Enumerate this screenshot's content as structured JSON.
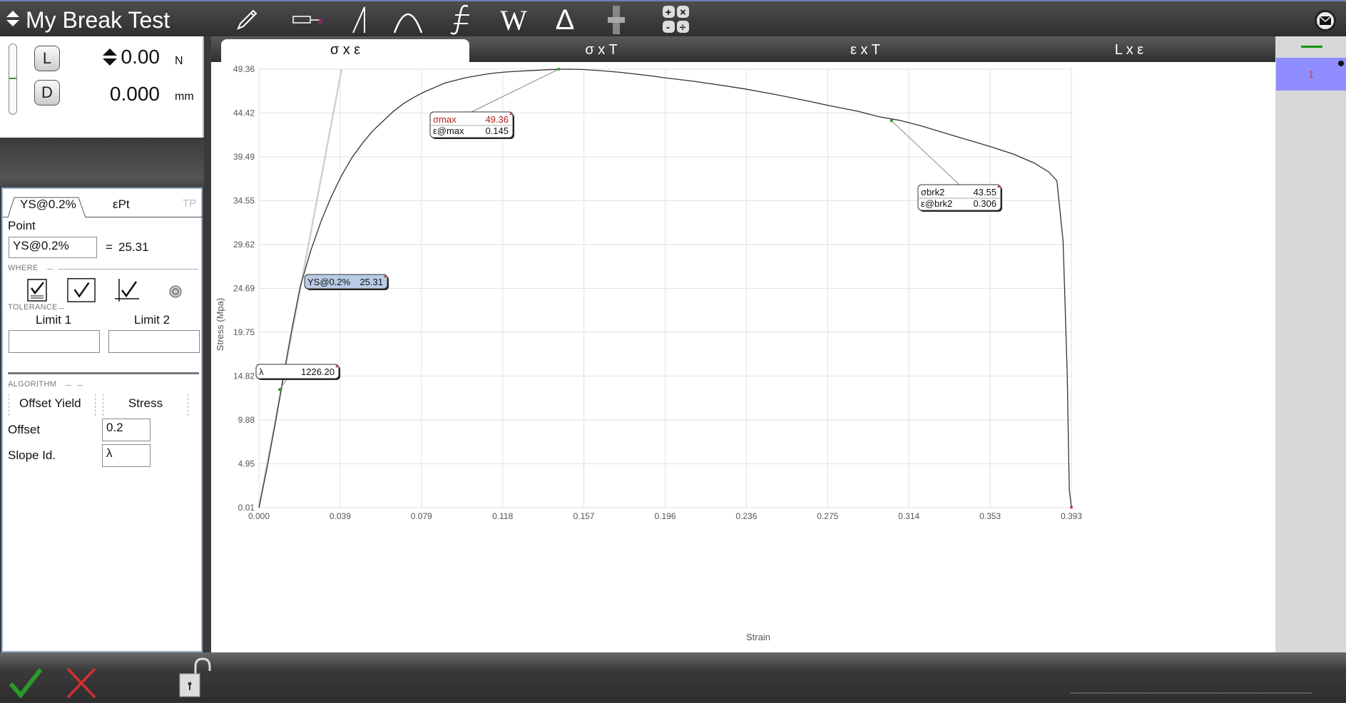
{
  "app": {
    "title": "My Break Test"
  },
  "toolbar": {
    "icons": [
      "pencil-icon",
      "extensometer-icon",
      "slope-icon",
      "curve-peak-icon",
      "integral-icon",
      "work-icon",
      "delta-icon",
      "specimen-icon",
      "calculator-icon"
    ],
    "labels": {
      "work": "W",
      "delta": "Δ"
    },
    "calc": [
      "+",
      "×",
      "-",
      "÷"
    ]
  },
  "readout": {
    "load_btn": "L",
    "disp_btn": "D",
    "load_value": "0.00",
    "load_unit": "N",
    "disp_value": "0.000",
    "disp_unit": "mm"
  },
  "props": {
    "tabs": [
      "YS@0.2%",
      "εPt",
      "TP"
    ],
    "point_label": "Point",
    "point_name": "YS@0.2%",
    "point_eq": "=",
    "point_value": "25.31",
    "where_header": "WHERE",
    "tolerance_header": "TOLERANCE",
    "limit1_label": "Limit 1",
    "limit2_label": "Limit 2",
    "limit1_value": "",
    "limit2_value": "",
    "algorithm_header": "ALGORITHM",
    "algo_option1": "Offset Yield",
    "algo_option2": "Stress",
    "offset_label": "Offset",
    "offset_value": "0.2",
    "slope_label": "Slope Id.",
    "slope_value": "λ"
  },
  "chart_tabs": [
    "σ x ε",
    "σ x T",
    "ε x T",
    "L x ε"
  ],
  "right_panel": {
    "item": "1"
  },
  "colors": {
    "accent_green": "#2a9b2a",
    "cancel_red": "#d23030",
    "selection": "#8f8dff",
    "label_highlight": "#b9cbe6",
    "max_red": "#b01c1c"
  },
  "chart_data": {
    "type": "line",
    "xlabel": "Strain",
    "ylabel": "Stress (Mpa)",
    "xlim": [
      0.0,
      0.393
    ],
    "ylim": [
      0.01,
      49.36
    ],
    "x_ticks": [
      "0.000",
      "0.039",
      "0.079",
      "0.118",
      "0.157",
      "0.196",
      "0.236",
      "0.275",
      "0.314",
      "0.353",
      "0.393"
    ],
    "y_ticks": [
      "0.01",
      "4.95",
      "9.88",
      "14.82",
      "19.75",
      "24.69",
      "29.62",
      "34.55",
      "39.49",
      "44.42",
      "49.36"
    ],
    "grid": true,
    "series": [
      {
        "x": [
          0.0,
          0.004,
          0.008,
          0.012,
          0.016,
          0.02,
          0.025,
          0.03,
          0.035,
          0.04,
          0.045,
          0.05,
          0.055,
          0.06,
          0.065,
          0.07,
          0.075,
          0.08,
          0.085,
          0.09,
          0.095,
          0.1,
          0.105,
          0.11,
          0.115,
          0.12,
          0.125,
          0.13,
          0.135,
          0.14,
          0.145,
          0.15,
          0.157,
          0.165,
          0.175,
          0.19,
          0.196,
          0.21,
          0.225,
          0.236,
          0.25,
          0.265,
          0.275,
          0.29,
          0.3,
          0.31,
          0.32,
          0.33,
          0.34,
          0.353,
          0.365,
          0.375,
          0.382,
          0.386,
          0.389,
          0.391,
          0.3915,
          0.392,
          0.393
        ],
        "y": [
          0.0,
          4.6,
          9.6,
          15.0,
          20.2,
          24.9,
          28.9,
          32.2,
          35.0,
          37.4,
          39.4,
          41.0,
          42.4,
          43.5,
          44.6,
          45.5,
          46.2,
          46.8,
          47.3,
          47.8,
          48.1,
          48.4,
          48.6,
          48.8,
          48.95,
          49.05,
          49.12,
          49.18,
          49.24,
          49.3,
          49.34,
          49.36,
          49.32,
          49.2,
          49.0,
          48.6,
          48.4,
          48.0,
          47.5,
          47.1,
          46.5,
          45.8,
          45.3,
          44.6,
          44.0,
          43.6,
          43.0,
          42.3,
          41.6,
          40.7,
          39.8,
          38.8,
          37.8,
          36.8,
          30.0,
          15.0,
          8.0,
          2.0,
          0.05
        ]
      },
      {
        "x": [
          0.0,
          0.04
        ],
        "y": [
          0.0,
          49.36
        ]
      }
    ],
    "annotations": [
      {
        "label": "σmax",
        "value": "49.36",
        "x": 0.145,
        "y": 49.36
      },
      {
        "label": "ε@max",
        "value": "0.145",
        "x": 0.145,
        "y": 49.36
      },
      {
        "label": "σbrk2",
        "value": "43.55",
        "x": 0.306,
        "y": 43.55
      },
      {
        "label": "ε@brk2",
        "value": "0.306",
        "x": 0.306,
        "y": 43.55
      },
      {
        "label": "YS@0.2%",
        "value": "25.31",
        "x": 0.023,
        "y": 25.31
      },
      {
        "label": "λ",
        "value": "1226.20",
        "x": 0.01,
        "y": 13.3
      }
    ]
  }
}
